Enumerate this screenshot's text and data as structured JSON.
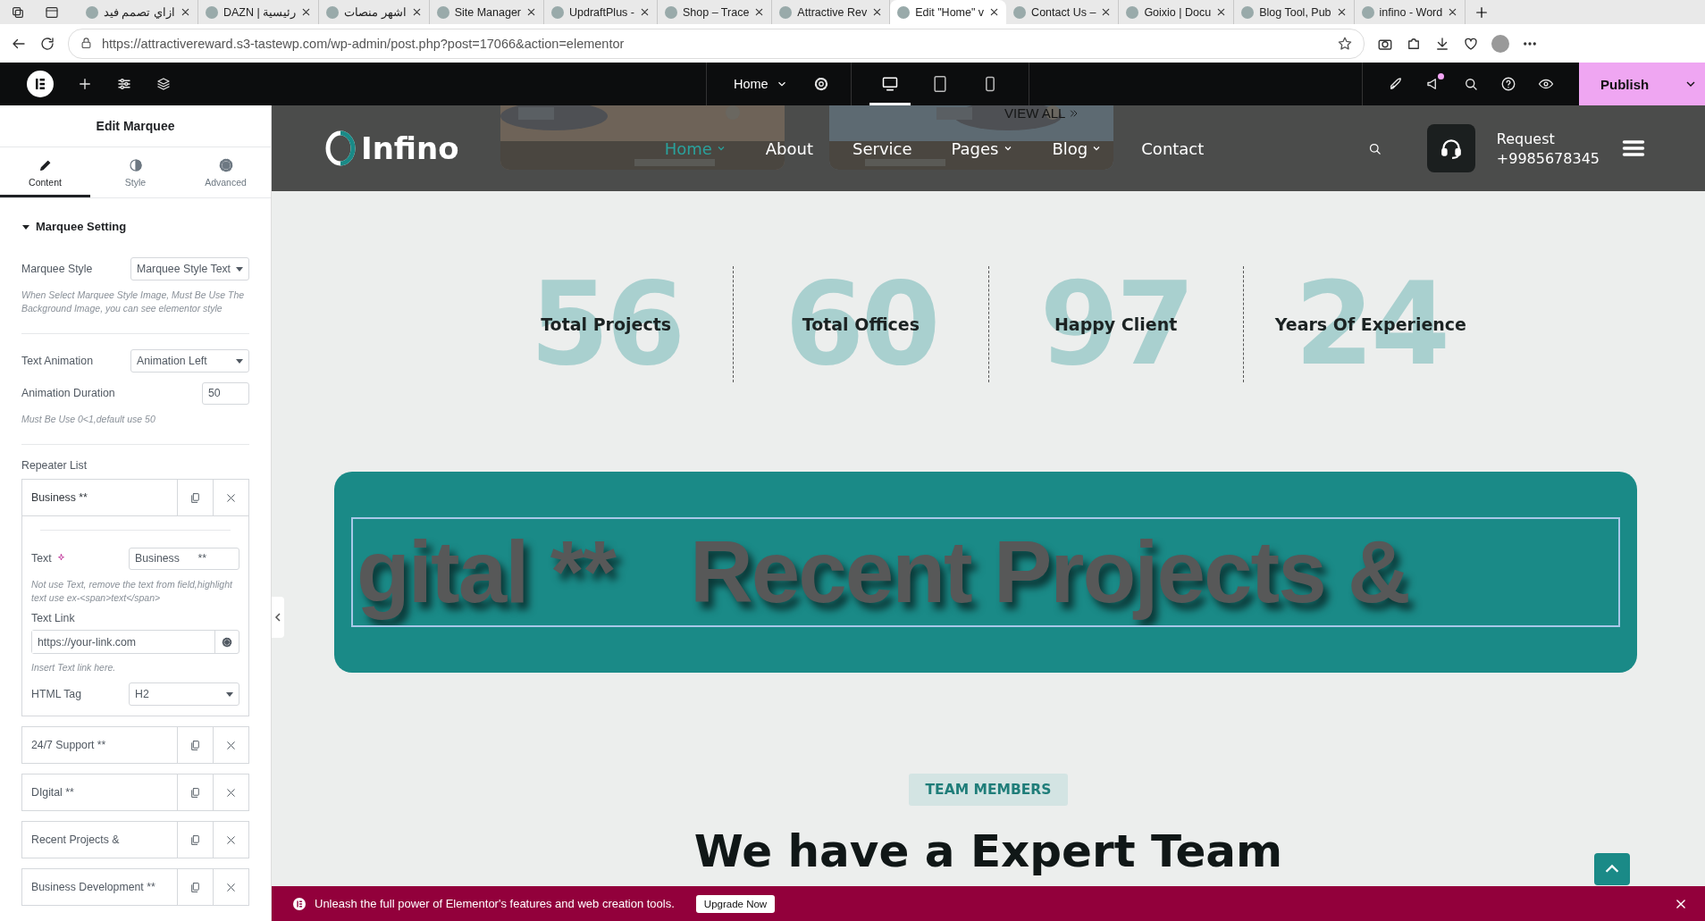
{
  "browser": {
    "tabs": [
      {
        "label": "ازاي تصمم فيد",
        "selected": false
      },
      {
        "label": "DAZN | رئيسية",
        "selected": false
      },
      {
        "label": "اشهر منصات",
        "selected": false
      },
      {
        "label": "Site Manager",
        "selected": false
      },
      {
        "label": "UpdraftPlus -",
        "selected": false
      },
      {
        "label": "Shop – Trace",
        "selected": false
      },
      {
        "label": "Attractive Rev",
        "selected": false
      },
      {
        "label": "Edit \"Home\" v",
        "selected": true
      },
      {
        "label": "Contact Us –",
        "selected": false
      },
      {
        "label": "Goixio | Docu",
        "selected": false
      },
      {
        "label": "Blog Tool, Pub",
        "selected": false
      },
      {
        "label": "infino - Word",
        "selected": false
      }
    ],
    "url": "https://attractivereward.s3-tastewp.com/wp-admin/post.php?post=17066&action=elementor"
  },
  "editor_bar": {
    "page": "Home",
    "devices": [
      {
        "kind": "desktop",
        "selected": true
      },
      {
        "kind": "tablet",
        "selected": false
      },
      {
        "kind": "mobile",
        "selected": false
      }
    ],
    "publish": "Publish"
  },
  "panel": {
    "title": "Edit Marquee",
    "tabs": [
      {
        "label": "Content",
        "kind": "pencil",
        "selected": true
      },
      {
        "label": "Style",
        "kind": "contrast",
        "selected": false
      },
      {
        "label": "Advanced",
        "kind": "gear",
        "selected": false
      }
    ],
    "section": {
      "title": "Marquee Setting",
      "expanded": true
    },
    "marquee_style": {
      "label": "Marquee Style",
      "value": "Marquee Style Text"
    },
    "style_note": "When Select Marquee Style Image, Must Be Use The Background Image, you can see elementor style",
    "text_animation": {
      "label": "Text Animation",
      "value": "Animation Left"
    },
    "animation_duration": {
      "label": "Animation Duration",
      "value": "50"
    },
    "duration_note": "Must Be Use 0<1,default use 50",
    "repeater": {
      "label": "Repeater List",
      "items": [
        {
          "title": "Business **",
          "expanded": true
        },
        {
          "title": "24/7 Support **",
          "expanded": false
        },
        {
          "title": "DIgital **",
          "expanded": false
        },
        {
          "title": "Recent Projects &",
          "expanded": false
        },
        {
          "title": "Business Development **",
          "expanded": false
        }
      ]
    },
    "item_editor": {
      "text_label": "Text",
      "text_value": "Business      **",
      "text_note": "Not use Text, remove the text from field,highlight text use ex-<span>text</span>",
      "link_label": "Text Link",
      "link_placeholder": "https://your-link.com",
      "link_note": "Insert Text link here.",
      "tag_label": "HTML Tag",
      "tag_value": "H2"
    }
  },
  "site": {
    "logo": "Infino",
    "view_all": "VIEW ALL",
    "menu": [
      {
        "label": "Home",
        "selected": true,
        "dropdown": true
      },
      {
        "label": "About",
        "selected": false,
        "dropdown": false
      },
      {
        "label": "Service",
        "selected": false,
        "dropdown": false
      },
      {
        "label": "Pages",
        "selected": false,
        "dropdown": true
      },
      {
        "label": "Blog",
        "selected": false,
        "dropdown": true
      },
      {
        "label": "Contact",
        "selected": false,
        "dropdown": false
      }
    ],
    "request_label": "Request",
    "phone": "+9985678345"
  },
  "stats": [
    {
      "number": "56",
      "label": "Total Projects"
    },
    {
      "number": "60",
      "label": "Total Offices"
    },
    {
      "number": "97",
      "label": "Happy Client"
    },
    {
      "number": "24",
      "label": "Years Of Experience"
    }
  ],
  "marquee": {
    "texts": [
      "gital **",
      "Recent Projects &"
    ],
    "selected": true
  },
  "team": {
    "badge": "TEAM MEMBERS",
    "heading": "We have a Expert Team"
  },
  "banner": {
    "text": "Unleash the full power of Elementor's features and web creation tools.",
    "button": "Upgrade Now"
  }
}
